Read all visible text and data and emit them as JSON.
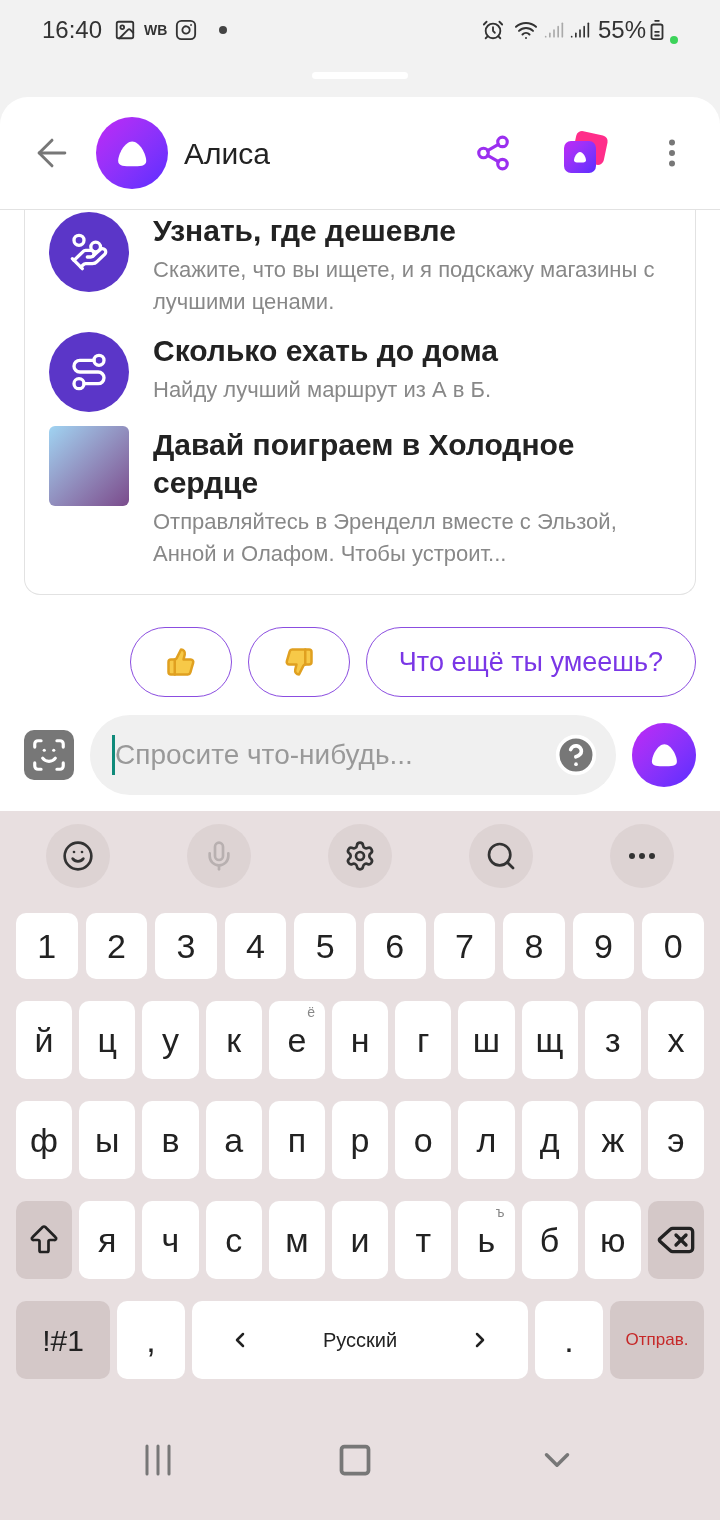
{
  "status_bar": {
    "time": "16:40",
    "app_badge": "WB",
    "battery": "55%"
  },
  "header": {
    "title": "Алиса"
  },
  "skills": [
    {
      "kind": "route-icon-price",
      "title": "Узнать, где дешевле",
      "description": "Скажите, что вы ищете, и я подскажу магазины с лучшими ценами."
    },
    {
      "kind": "route-icon-route",
      "title": "Сколько ехать до дома",
      "description": "Найду лучший маршрут из А в Б."
    },
    {
      "kind": "picture",
      "title": "Давай поиграем в Холодное сердце",
      "description": "Отправляйтесь в Эренделл вместе с Эльзой, Анной и Олафом. Чтобы устроит..."
    }
  ],
  "suggestions": [
    {
      "kind": "like"
    },
    {
      "kind": "dislike"
    },
    {
      "kind": "text",
      "label": "Что ещё ты умеешь?"
    }
  ],
  "input": {
    "placeholder": "Спросите что-нибудь..."
  },
  "keyboard": {
    "toolbar": [
      {
        "kind": "emoji",
        "disabled": false
      },
      {
        "kind": "mic",
        "disabled": true
      },
      {
        "kind": "settings",
        "disabled": false
      },
      {
        "kind": "search",
        "disabled": false
      },
      {
        "kind": "more",
        "disabled": false
      }
    ],
    "number_keys": [
      "1",
      "2",
      "3",
      "4",
      "5",
      "6",
      "7",
      "8",
      "9",
      "0"
    ],
    "rows": [
      [
        {
          "kind": "char",
          "label": "й"
        },
        {
          "kind": "char",
          "label": "ц"
        },
        {
          "kind": "char",
          "label": "у"
        },
        {
          "kind": "char",
          "label": "к"
        },
        {
          "kind": "char",
          "label": "е",
          "hint": "ё"
        },
        {
          "kind": "char",
          "label": "н"
        },
        {
          "kind": "char",
          "label": "г"
        },
        {
          "kind": "char",
          "label": "ш"
        },
        {
          "kind": "char",
          "label": "щ"
        },
        {
          "kind": "char",
          "label": "з"
        },
        {
          "kind": "char",
          "label": "х"
        }
      ],
      [
        {
          "kind": "char",
          "label": "ф"
        },
        {
          "kind": "char",
          "label": "ы"
        },
        {
          "kind": "char",
          "label": "в"
        },
        {
          "kind": "char",
          "label": "а"
        },
        {
          "kind": "char",
          "label": "п"
        },
        {
          "kind": "char",
          "label": "р"
        },
        {
          "kind": "char",
          "label": "о"
        },
        {
          "kind": "char",
          "label": "л"
        },
        {
          "kind": "char",
          "label": "д"
        },
        {
          "kind": "char",
          "label": "ж"
        },
        {
          "kind": "char",
          "label": "э"
        }
      ],
      [
        {
          "kind": "shift"
        },
        {
          "kind": "char",
          "label": "я"
        },
        {
          "kind": "char",
          "label": "ч"
        },
        {
          "kind": "char",
          "label": "с"
        },
        {
          "kind": "char",
          "label": "м"
        },
        {
          "kind": "char",
          "label": "и"
        },
        {
          "kind": "char",
          "label": "т"
        },
        {
          "kind": "char",
          "label": "ь",
          "hint": "ъ"
        },
        {
          "kind": "char",
          "label": "б"
        },
        {
          "kind": "char",
          "label": "ю"
        },
        {
          "kind": "backspace"
        }
      ]
    ],
    "bottom_keys": [
      {
        "kind": "symbols",
        "label": "!#1"
      },
      {
        "kind": "char",
        "label": ","
      },
      {
        "kind": "space",
        "label": "Русский"
      },
      {
        "kind": "char",
        "label": "."
      },
      {
        "kind": "send",
        "label": "Отправ."
      }
    ]
  }
}
